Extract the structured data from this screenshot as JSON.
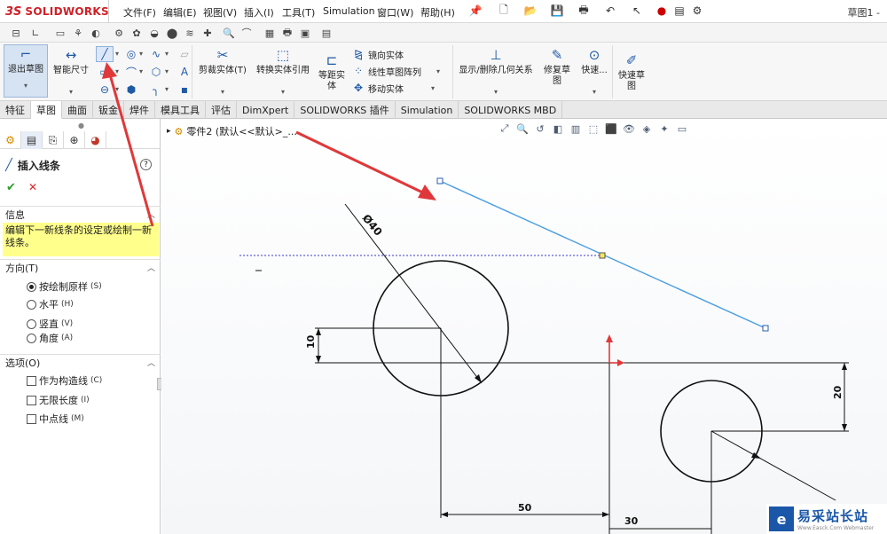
{
  "app": {
    "logo_prefix": "3S",
    "logo_text": "SOLIDWORKS",
    "document_title": "草图1 -",
    "menus": [
      "文件(F)",
      "编辑(E)",
      "视图(V)",
      "插入(I)",
      "工具(T)",
      "Simulation",
      "窗口(W)",
      "帮助(H)"
    ]
  },
  "command_manager": {
    "exit_sketch": "退出草图",
    "smart_dimension": "智能尺寸",
    "trim_entities": "剪裁实体(T)",
    "convert_entities": "转换实体引用",
    "offset_entities_1": "等距实",
    "offset_entities_2": "体",
    "mirror_entities": "镜向实体",
    "linear_pattern": "线性草图阵列",
    "move_entities": "移动实体",
    "display_relations": "显示/删除几何关系",
    "repair_sketch_1": "修复草",
    "repair_sketch_2": "图",
    "quick_snaps": "快速...",
    "rapid_sketch_1": "快速草",
    "rapid_sketch_2": "图"
  },
  "tabs": [
    "特征",
    "草图",
    "曲面",
    "钣金",
    "焊件",
    "模具工具",
    "评估",
    "DimXpert",
    "SOLIDWORKS 插件",
    "Simulation",
    "SOLIDWORKS MBD"
  ],
  "active_tab": "草图",
  "property_manager": {
    "title": "插入线条",
    "info_header": "信息",
    "info_text": "编辑下一新线条的设定或绘制一新线条。",
    "orientation_header": "方向(T)",
    "orientation_options": [
      {
        "label": "按绘制原样",
        "accel": "(S)",
        "selected": true
      },
      {
        "label": "水平",
        "accel": "(H)",
        "selected": false
      },
      {
        "label": "竖直",
        "accel": "(V)",
        "selected": false
      },
      {
        "label": "角度",
        "accel": "(A)",
        "selected": false
      }
    ],
    "options_header": "选项(O)",
    "options": [
      {
        "label": "作为构造线",
        "accel": "(C)",
        "checked": false
      },
      {
        "label": "无限长度",
        "accel": "(I)",
        "checked": false
      },
      {
        "label": "中点线",
        "accel": "(M)",
        "checked": false
      }
    ]
  },
  "canvas": {
    "breadcrumb": "零件2 (默认<<默认>_...",
    "dimensions": {
      "diameter": "Ø40",
      "vertical_left": "10",
      "vertical_right": "20",
      "horizontal_50": "50",
      "horizontal_30": "30"
    }
  },
  "watermark": {
    "badge": "e",
    "main": "易采站长站",
    "sub": "Www.Easck.Com Webmaster"
  },
  "colors": {
    "accent_red": "#e0383a",
    "sketch_blue": "#4a9ee0",
    "info_yellow": "#ffff8c",
    "watermark_blue": "#1a57a8"
  }
}
